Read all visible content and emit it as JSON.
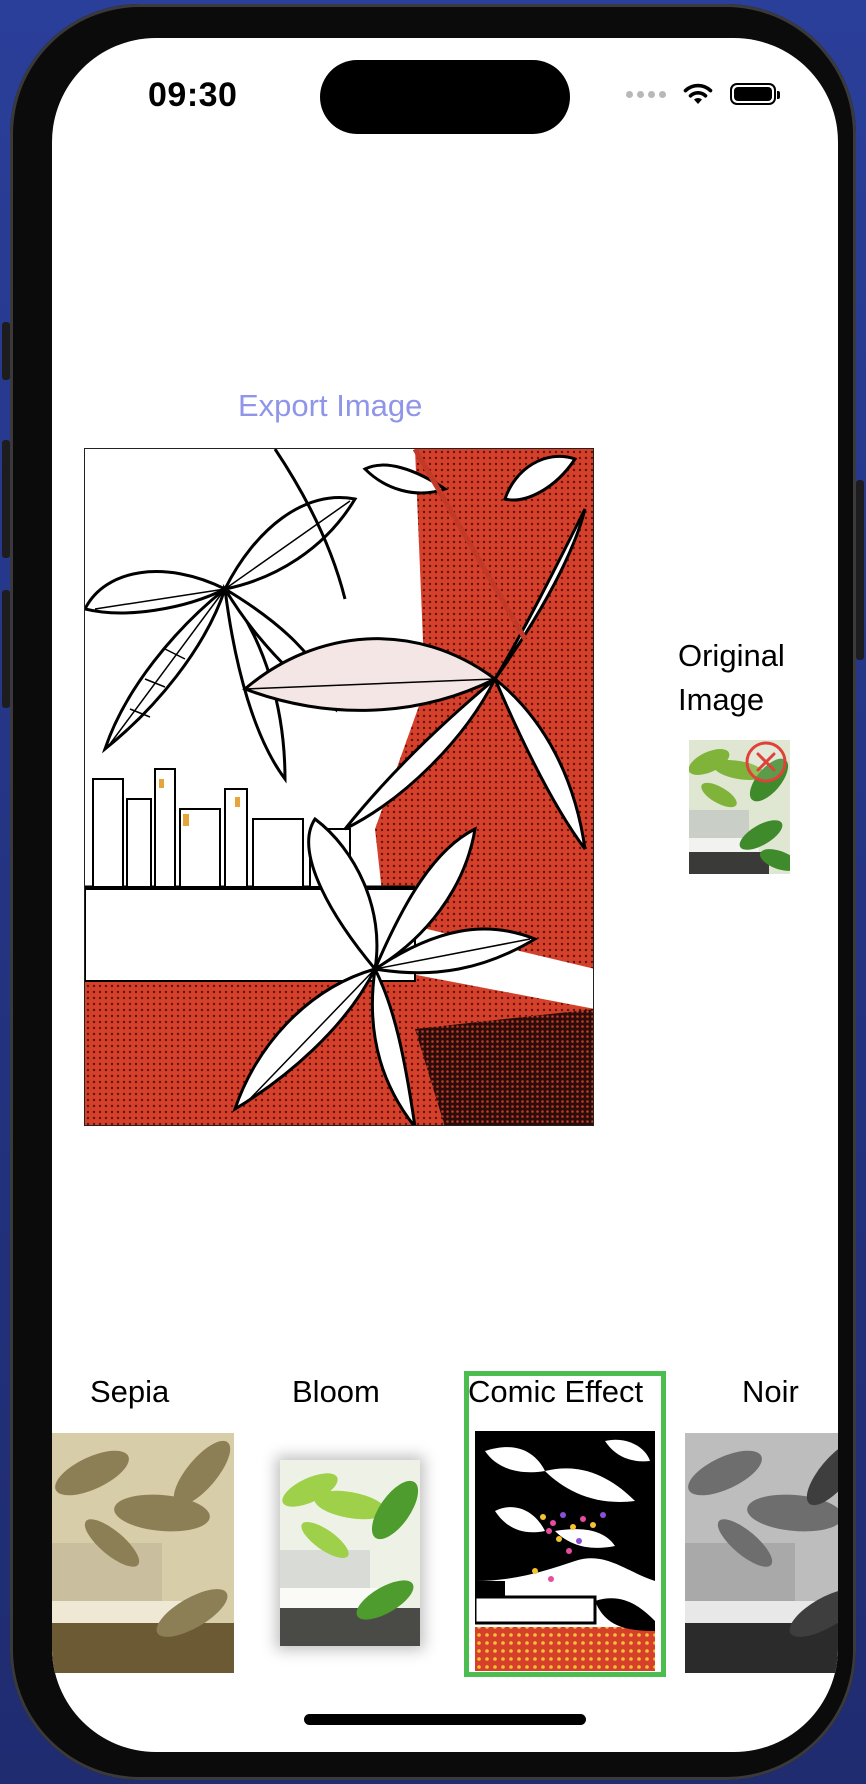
{
  "status_bar": {
    "time": "09:30"
  },
  "toolbar": {
    "export_label": "Export Image"
  },
  "original": {
    "label": "Original Image"
  },
  "filters": [
    {
      "label": "Sepia"
    },
    {
      "label": "Bloom"
    },
    {
      "label": "Comic Effect",
      "selected": true
    },
    {
      "label": "Noir"
    }
  ],
  "colors": {
    "accent": "#8f95e8",
    "selection": "#4bbe4f",
    "comic_red": "#d6402a",
    "remove_badge": "#e0413a"
  }
}
